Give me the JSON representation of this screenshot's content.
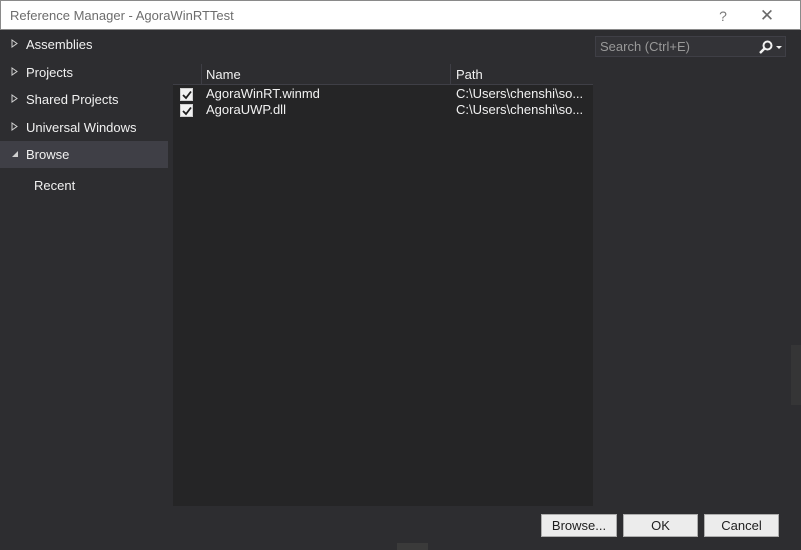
{
  "window": {
    "title": "Reference Manager - AgoraWinRTTest",
    "help_label": "?",
    "close_label": "✕"
  },
  "nav": {
    "items": [
      {
        "label": "Assemblies",
        "expanded": false
      },
      {
        "label": "Projects",
        "expanded": false
      },
      {
        "label": "Shared Projects",
        "expanded": false
      },
      {
        "label": "Universal Windows",
        "expanded": false
      },
      {
        "label": "Browse",
        "expanded": true,
        "selected": true
      }
    ],
    "sub_item": "Recent"
  },
  "search": {
    "placeholder": "Search (Ctrl+E)"
  },
  "table": {
    "columns": {
      "name": "Name",
      "path": "Path"
    },
    "rows": [
      {
        "checked": true,
        "name": "AgoraWinRT.winmd",
        "path": "C:\\Users\\chenshi\\so..."
      },
      {
        "checked": true,
        "name": "AgoraUWP.dll",
        "path": "C:\\Users\\chenshi\\so..."
      }
    ]
  },
  "buttons": {
    "browse": "Browse...",
    "ok": "OK",
    "cancel": "Cancel"
  },
  "colors": {
    "background": "#2d2d30",
    "panel": "#252526",
    "selected": "#3f3f46",
    "text": "#f1f1f1"
  }
}
